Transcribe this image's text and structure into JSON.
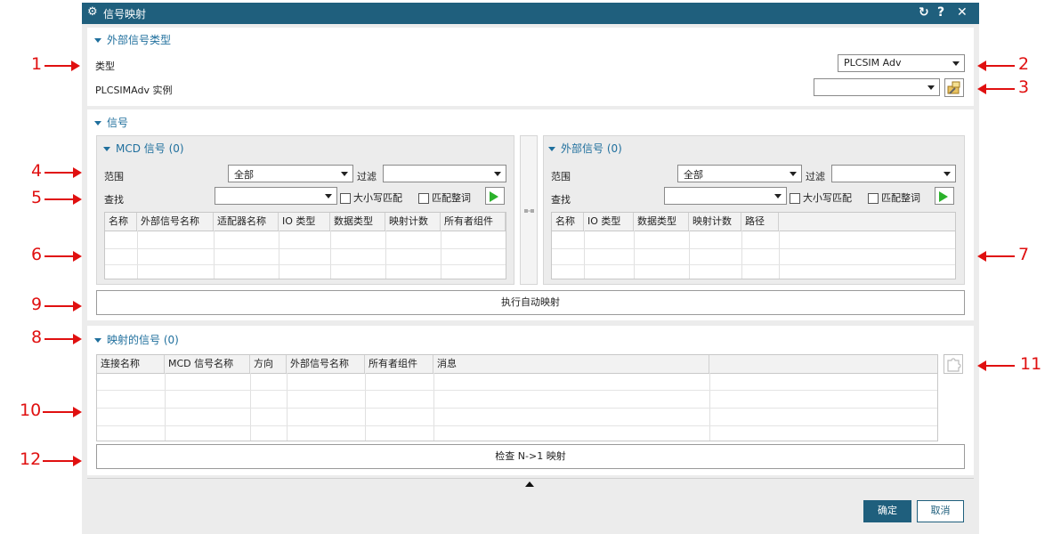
{
  "window": {
    "title": "信号映射",
    "icons": [
      "gear-icon",
      "reset-icon",
      "help-icon",
      "close-icon"
    ],
    "reset_glyph": "↻",
    "help_glyph": "?",
    "close_glyph": "✕"
  },
  "external_type_section": {
    "title": "外部信号类型",
    "type_label": "类型",
    "type_value": "PLCSIM Adv",
    "instance_label": "PLCSIMAdv 实例",
    "instance_value": ""
  },
  "signal_section": {
    "title": "信号",
    "mcd": {
      "title": "MCD 信号 (0)",
      "scope_label": "范围",
      "scope_value": "全部",
      "filter_label": "过滤",
      "filter_value": "",
      "find_label": "查找",
      "find_value": "",
      "case_match": "大小写匹配",
      "whole_word": "匹配整词",
      "columns": [
        "名称",
        "外部信号名称",
        "适配器名称",
        "IO 类型",
        "数据类型",
        "映射计数",
        "所有者组件"
      ]
    },
    "external": {
      "title": "外部信号 (0)",
      "scope_label": "范围",
      "scope_value": "全部",
      "filter_label": "过滤",
      "filter_value": "",
      "find_label": "查找",
      "find_value": "",
      "case_match": "大小写匹配",
      "whole_word": "匹配整词",
      "columns": [
        "名称",
        "IO 类型",
        "数据类型",
        "映射计数",
        "路径"
      ]
    },
    "auto_map_button": "执行自动映射"
  },
  "mapped_section": {
    "title": "映射的信号 (0)",
    "columns": [
      "连接名称",
      "MCD 信号名称",
      "方向",
      "外部信号名称",
      "所有者组件",
      "消息"
    ],
    "check_button": "检查 N->1 映射"
  },
  "footer": {
    "ok": "确定",
    "cancel": "取消"
  },
  "annotations": [
    "1",
    "2",
    "3",
    "4",
    "5",
    "6",
    "7",
    "8",
    "9",
    "10",
    "11",
    "12"
  ],
  "colors": {
    "titlebar": "#1f5f7d",
    "section_title": "#1f6f9d",
    "annotation": "#e01010",
    "go_arrow": "#2bb22b"
  }
}
